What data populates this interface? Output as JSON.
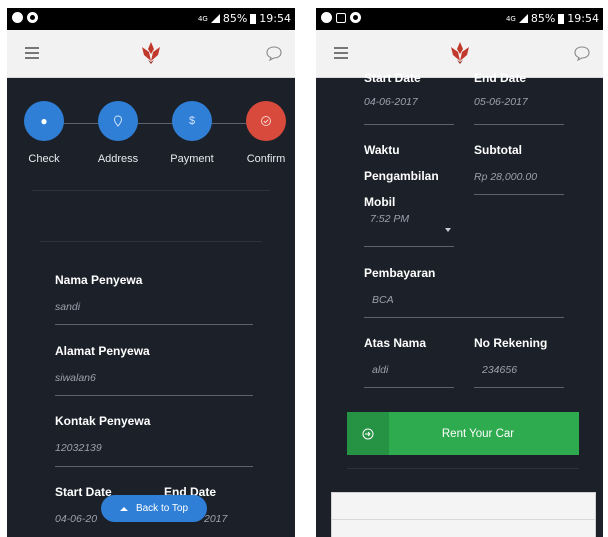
{
  "colors": {
    "bg_dark": "#1c2129",
    "step_blue": "#2f7fd6",
    "step_red": "#d84a3c",
    "green": "#2eaa4f",
    "logo_red": "#c0392b"
  },
  "left": {
    "status": {
      "icons_left": [
        "whatsapp-icon",
        "camera-icon"
      ],
      "network": "4G",
      "battery": "85%",
      "time": "19:54"
    },
    "appbar": {
      "menu_icon": "hamburger-icon",
      "logo_icon": "lotus-logo",
      "chat_icon": "chat-bubble-icon"
    },
    "steps": [
      {
        "label": "Check",
        "icon": "dot-icon"
      },
      {
        "label": "Address",
        "icon": "location-pin-icon"
      },
      {
        "label": "Payment",
        "icon": "dollar-icon"
      },
      {
        "label": "Confirm",
        "icon": "check-circle-icon"
      }
    ],
    "fields": {
      "nama": {
        "label": "Nama Penyewa",
        "value": "sandi"
      },
      "alamat": {
        "label": "Alamat Penyewa",
        "value": "siwalan6"
      },
      "kontak": {
        "label": "Kontak Penyewa",
        "value": "12032139"
      },
      "start": {
        "label": "Start Date",
        "value": "04-06-20"
      },
      "end": {
        "label": "End Date",
        "value": "2017"
      }
    },
    "back_to_top": "Back to Top"
  },
  "right": {
    "status": {
      "icons_left": [
        "whatsapp-icon",
        "image-icon",
        "camera-icon"
      ],
      "network": "4G",
      "battery": "85%",
      "time": "19:54"
    },
    "fields": {
      "start": {
        "label": "Start Date",
        "value": "04-06-2017"
      },
      "end": {
        "label": "End Date",
        "value": "05-06-2017"
      },
      "waktu": {
        "label_1": "Waktu",
        "label_2": "Pengambilan",
        "label_3": "Mobil",
        "value": "7:52 PM"
      },
      "subtotal": {
        "label": "Subtotal",
        "value": "Rp 28,000.00"
      },
      "pembayaran": {
        "label": "Pembayaran",
        "value": "BCA"
      },
      "atas_nama": {
        "label": "Atas Nama",
        "value": "aldi"
      },
      "rekening": {
        "label": "No Rekening",
        "value": "234656"
      }
    },
    "rent_button": {
      "label": "Rent Your Car",
      "icon": "sign-in-icon"
    }
  }
}
